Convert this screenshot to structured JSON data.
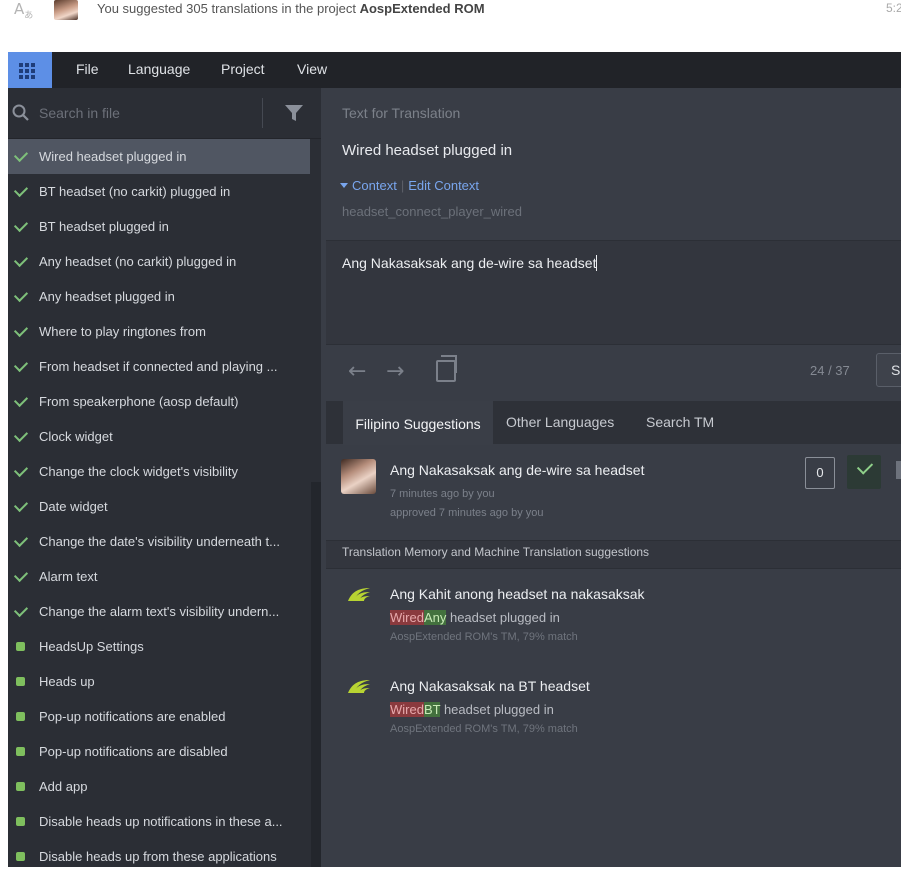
{
  "notification": {
    "icon": "translate-icon",
    "icon_text": "A",
    "message_prefix": "You suggested 305 translations in the project ",
    "project": "AospExtended ROM",
    "time": "5:2"
  },
  "menu": {
    "apps_icon": "grid-icon",
    "items": [
      "File",
      "Language",
      "Project",
      "View"
    ]
  },
  "sidebar": {
    "search_placeholder": "Search in file",
    "strings": [
      {
        "label": "Wired headset plugged in",
        "status": "translated",
        "selected": true
      },
      {
        "label": "BT headset (no carkit) plugged in",
        "status": "translated"
      },
      {
        "label": "BT headset plugged in",
        "status": "translated"
      },
      {
        "label": "Any headset (no carkit) plugged in",
        "status": "translated"
      },
      {
        "label": "Any headset plugged in",
        "status": "translated"
      },
      {
        "label": "Where to play ringtones from",
        "status": "translated"
      },
      {
        "label": "From headset if connected and playing ...",
        "status": "translated"
      },
      {
        "label": "From speakerphone (aosp default)",
        "status": "translated"
      },
      {
        "label": "Clock widget",
        "status": "translated"
      },
      {
        "label": "Change the clock widget's visibility",
        "status": "translated"
      },
      {
        "label": "Date widget",
        "status": "translated"
      },
      {
        "label": "Change the date's visibility underneath t...",
        "status": "translated"
      },
      {
        "label": "Alarm text",
        "status": "translated"
      },
      {
        "label": "Change the alarm text's visibility undern...",
        "status": "translated"
      },
      {
        "label": "HeadsUp Settings",
        "status": "approved"
      },
      {
        "label": "Heads up",
        "status": "approved"
      },
      {
        "label": "Pop-up notifications are enabled",
        "status": "approved"
      },
      {
        "label": "Pop-up notifications are disabled",
        "status": "approved"
      },
      {
        "label": "Add app",
        "status": "approved"
      },
      {
        "label": "Disable heads up notifications in these a...",
        "status": "approved"
      },
      {
        "label": "Disable heads up from these applications",
        "status": "approved"
      }
    ]
  },
  "editor": {
    "source_heading": "Text for Translation",
    "source_text": "Wired headset plugged in",
    "context_label": "Context",
    "edit_context_label": "Edit Context",
    "context_key": "headset_connect_player_wired",
    "translation_value": "Ang Nakasaksak ang de-wire sa headset",
    "position": "24 / 37",
    "save_label": "S"
  },
  "tabs": [
    "Filipino Suggestions",
    "Other Languages",
    "Search TM"
  ],
  "suggestion": {
    "text": "Ang Nakasaksak ang de-wire sa headset",
    "meta1": "7 minutes ago by you",
    "meta2": "approved 7 minutes ago by you",
    "votes": "0"
  },
  "tm_heading": "Translation Memory and Machine Translation suggestions",
  "tm_suggestions": [
    {
      "text": "Ang Kahit anong headset na nakasaksak",
      "diff_removed": "Wired",
      "diff_added": "Any",
      "diff_rest": " headset plugged in",
      "source": "AospExtended ROM's TM, 79% match"
    },
    {
      "text": "Ang Nakasaksak na BT headset",
      "diff_removed": "Wired",
      "diff_added": "BT",
      "diff_rest": " headset plugged in",
      "source": "AospExtended ROM's TM, 79% match"
    }
  ],
  "colors": {
    "accent": "#5d8fe6",
    "translated_check": "#7ec07a",
    "approved_dot": "#7fbf5e",
    "link": "#79a6ee",
    "diff_removed": "#8a3a3e",
    "diff_added": "#43713e",
    "tm_logo": "#b8d432"
  }
}
